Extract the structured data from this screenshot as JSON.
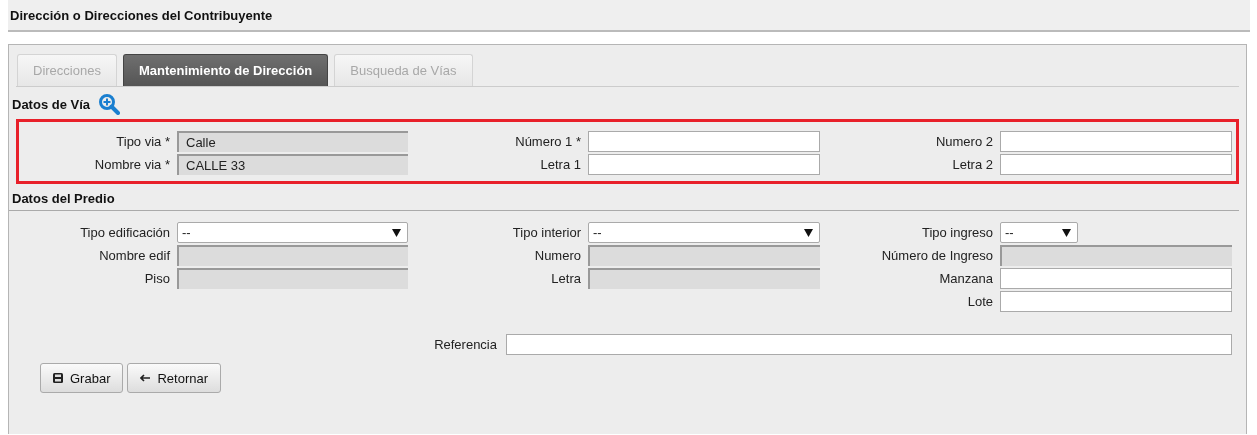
{
  "page_title": "Dirección o Direcciones del Contribuyente",
  "tabs": [
    {
      "label": "Direcciones",
      "selected": false
    },
    {
      "label": "Mantenimiento de Dirección",
      "selected": true
    },
    {
      "label": "Busqueda de Vías",
      "selected": false
    }
  ],
  "via": {
    "title": "Datos de Vía",
    "highlighted": true,
    "rows": [
      [
        {
          "label": "Tipo via *",
          "kind": "readonly",
          "value": "Calle"
        },
        {
          "label": "Número 1 *",
          "kind": "text"
        },
        {
          "label": "Numero 2",
          "kind": "text"
        }
      ],
      [
        {
          "label": "Nombre via *",
          "kind": "readonly",
          "value": "CALLE 33"
        },
        {
          "label": "Letra 1",
          "kind": "text"
        },
        {
          "label": "Letra 2",
          "kind": "text"
        }
      ]
    ]
  },
  "predio": {
    "title": "Datos del Predio",
    "rows": [
      [
        {
          "label": "Tipo edificación",
          "kind": "select",
          "value": "--"
        },
        {
          "label": "Tipo interior",
          "kind": "select",
          "value": "--"
        },
        {
          "label": "Tipo ingreso",
          "kind": "select-short",
          "value": "--"
        }
      ],
      [
        {
          "label": "Nombre edif",
          "kind": "readonly"
        },
        {
          "label": "Numero",
          "kind": "readonly"
        },
        {
          "label": "Número de Ingreso",
          "kind": "readonly"
        }
      ],
      [
        {
          "label": "Piso",
          "kind": "readonly"
        },
        {
          "label": "Letra",
          "kind": "readonly"
        },
        {
          "label": "Manzana",
          "kind": "text"
        }
      ],
      [
        "",
        "",
        {
          "label": "Lote",
          "kind": "text"
        }
      ]
    ]
  },
  "referencia": {
    "label": "Referencia"
  },
  "buttons": [
    {
      "label": "Grabar"
    },
    {
      "label": "Retornar"
    }
  ]
}
